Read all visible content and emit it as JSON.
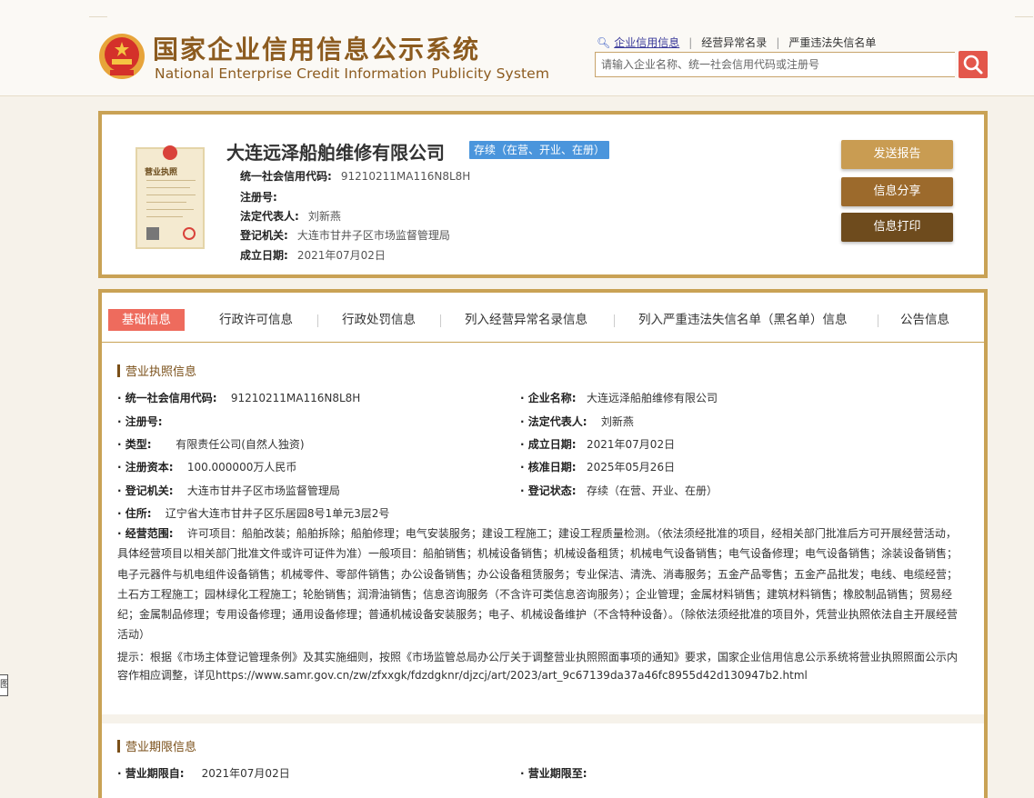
{
  "header": {
    "title_cn": "国家企业信用信息公示系统",
    "title_en": "National Enterprise Credit Information Publicity System",
    "links": [
      "企业信用信息",
      "经营异常名录",
      "严重违法失信名单"
    ],
    "search_placeholder": "请输入企业名称、统一社会信用代码或注册号",
    "side_tag": "图"
  },
  "company": {
    "name": "大连远泽船舶维修有限公司",
    "status": "存续（在营、开业、在册）",
    "license_title": "营业执照",
    "credit_code_label": "统一社会信用代码:",
    "credit_code": "91210211MA116N8L8H",
    "reg_no_label": "注册号:",
    "legal_rep_label": "法定代表人:",
    "legal_rep": "刘新燕",
    "authority_label": "登记机关:",
    "authority": "大连市甘井子区市场监督管理局",
    "est_date_label": "成立日期:",
    "est_date": "2021年07月02日"
  },
  "actions": [
    "发送报告",
    "信息分享",
    "信息打印"
  ],
  "tabs": [
    "基础信息",
    "行政许可信息",
    "行政处罚信息",
    "列入经营异常名录信息",
    "列入严重违法失信名单（黑名单）信息",
    "公告信息"
  ],
  "license_section": {
    "title": "营业执照信息",
    "fields": {
      "credit_code_label": "· 统一社会信用代码:",
      "credit_code": "91210211MA116N8L8H",
      "company_name_label": "· 企业名称:",
      "company_name": "大连远泽船舶维修有限公司",
      "reg_no_label": "· 注册号:",
      "legal_rep_label": "· 法定代表人:",
      "legal_rep": "刘新燕",
      "type_label": "· 类型:",
      "type": "有限责任公司(自然人独资)",
      "est_date_label": "· 成立日期:",
      "est_date": "2021年07月02日",
      "capital_label": "· 注册资本:",
      "capital": "100.000000万人民币",
      "approve_date_label": "· 核准日期:",
      "approve_date": "2025年05月26日",
      "authority_label": "· 登记机关:",
      "authority": "大连市甘井子区市场监督管理局",
      "reg_status_label": "· 登记状态:",
      "reg_status": "存续（在营、开业、在册）",
      "address_label": "· 住所:",
      "address": "辽宁省大连市甘井子区乐居园8号1单元3层2号",
      "scope_label": "· 经营范围:",
      "scope": "许可项目：船舶改装；船舶拆除；船舶修理；电气安装服务；建设工程施工；建设工程质量检测。（依法须经批准的项目，经相关部门批准后方可开展经营活动，具体经营项目以相关部门批准文件或许可证件为准）一般项目：船舶销售；机械设备销售；机械设备租赁；机械电气设备销售；电气设备修理；电气设备销售；涂装设备销售；电子元器件与机电组件设备销售；机械零件、零部件销售；办公设备销售；办公设备租赁服务；专业保洁、清洗、消毒服务；五金产品零售；五金产品批发；电线、电缆经营；土石方工程施工；园林绿化工程施工；轮胎销售；润滑油销售；信息咨询服务（不含许可类信息咨询服务）；企业管理；金属材料销售；建筑材料销售；橡胶制品销售；贸易经纪；金属制品修理；专用设备修理；通用设备修理；普通机械设备安装服务；电子、机械设备维护（不含特种设备）。（除依法须经批准的项目外，凭营业执照依法自主开展经营活动）"
    },
    "tip": "提示：根据《市场主体登记管理条例》及其实施细则，按照《市场监管总局办公厅关于调整营业执照照面事项的通知》要求，国家企业信用信息公示系统将营业执照照面公示内容作相应调整，详见https://www.samr.gov.cn/zw/zfxxgk/fdzdgknr/djzcj/art/2023/art_9c67139da37a46fc8955d42d130947b2.html"
  },
  "term_section": {
    "title": "营业期限信息",
    "from_label": "· 营业期限自:",
    "from": "2021年07月02日",
    "to_label": "· 营业期限至:"
  }
}
